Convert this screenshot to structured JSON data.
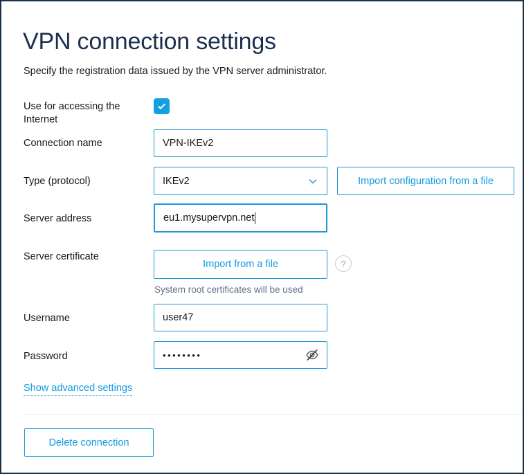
{
  "window": {
    "title": "VPN connection settings",
    "intro": "Specify the registration data issued by the VPN server administrator.",
    "border_color": "#1c3048",
    "accent_color": "#0f9ae0",
    "title_color": "#1c2f4e"
  },
  "form": {
    "internet": {
      "label": "Use for accessing the Internet",
      "checked": true
    },
    "connection_name": {
      "label": "Connection name",
      "value": "VPN-IKEv2"
    },
    "type": {
      "label": "Type (protocol)",
      "value": "IKEv2",
      "options": [
        "IKEv2"
      ]
    },
    "import_config_button": {
      "label": "Import configuration from a file"
    },
    "server_address": {
      "label": "Server address",
      "value": "eu1.mysupervpn.net",
      "focused": true
    },
    "server_certificate": {
      "label": "Server certificate",
      "import_button_label": "Import from a file",
      "helper_text": "System root certificates will be used",
      "help_icon": "?"
    },
    "username": {
      "label": "Username",
      "value": "user47"
    },
    "password": {
      "label": "Password",
      "value": "••••••••",
      "reveal_icon": "eye-off-icon"
    }
  },
  "footer": {
    "advanced_link": "Show advanced settings",
    "delete_button": "Delete connection"
  }
}
